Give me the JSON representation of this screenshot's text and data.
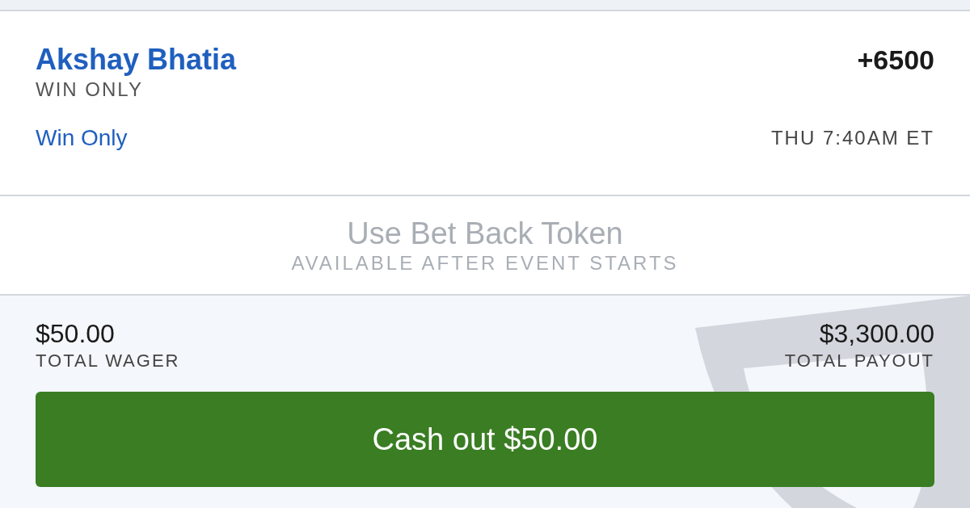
{
  "bet": {
    "selection": "Akshay Bhatia",
    "odds": "+6500",
    "market": "WIN ONLY",
    "bet_type": "Win Only",
    "start_time": "THU 7:40AM ET"
  },
  "bet_back": {
    "title": "Use Bet Back Token",
    "subtitle": "AVAILABLE AFTER EVENT STARTS",
    "disabled": true
  },
  "totals": {
    "wager": "$50.00",
    "wager_label": "TOTAL WAGER",
    "payout": "$3,300.00",
    "payout_label": "TOTAL PAYOUT"
  },
  "cash_out_button": "Cash out $50.00"
}
